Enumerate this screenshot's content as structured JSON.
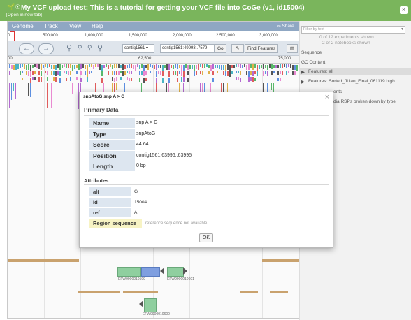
{
  "title_bar": {
    "title": "My VCF upload test: This is a tutorial for getting your VCF file into CoGe (v1, id15004)",
    "open_link": "[Open in new tab]",
    "close": "×"
  },
  "menu": [
    "Genome",
    "Track",
    "View",
    "Help"
  ],
  "share_label": "∞ Share",
  "overview_ticks": [
    "0",
    "500,000",
    "1,000,000",
    "1,500,000",
    "2,000,000",
    "2,500,000",
    "3,000,000"
  ],
  "nav": {
    "back": "←",
    "forward": "→",
    "contig_select": "contig1561",
    "location_value": "contig1561:49993..7579",
    "go_label": "Go",
    "find_features_label": "Find Features"
  },
  "scale_ticks": [
    "00",
    "62,500",
    "75,000"
  ],
  "sidebar": {
    "filter_placeholder": "Filter by text",
    "experiments_shown": "0 of 12 experiments shown",
    "notebooks_shown": "2 of 2 notebooks shown",
    "sequence_label": "Sequence",
    "gc_content_label": "GC Content",
    "features_all": "Features: all",
    "features_sorted": "Features: Sorted_JLian_Final_061119.high",
    "partial_1": "ents",
    "partial_2": "dia RSPs broken down by type"
  },
  "dialog": {
    "title": "snpAtoG snp A > G",
    "close": "×",
    "primary_heading": "Primary Data",
    "primary": [
      {
        "key": "Name",
        "value": "snp A > G"
      },
      {
        "key": "Type",
        "value": "snpAtoG"
      },
      {
        "key": "Score",
        "value": "44.64"
      },
      {
        "key": "Position",
        "value": "contig1561:63996..63995"
      },
      {
        "key": "Length",
        "value": "0 bp"
      }
    ],
    "attributes_heading": "Attributes",
    "attributes": [
      {
        "key": "alt",
        "value": "G"
      },
      {
        "key": "id",
        "value": "15004"
      },
      {
        "key": "ref",
        "value": "A"
      }
    ],
    "region_label": "Region sequence",
    "region_value": "reference sequence not available",
    "ok_label": "OK"
  },
  "genes": [
    "EFW9900010599",
    "EFW9900010601",
    "EFW9900010600"
  ],
  "colors": {
    "title_green": "#7ab55c",
    "menu_blue": "#8fa7c3",
    "key_bg": "#dde6f0",
    "region_bg": "#f7f3c4",
    "tan_feature": "#c9a26e",
    "gene_green": "#8fcf9f",
    "gene_blue": "#7f9fe0"
  },
  "icons": [
    "plant-icon",
    "user-icon",
    "zoom-out-icon",
    "zoom-in-icon",
    "highlight-icon",
    "close-icon"
  ]
}
